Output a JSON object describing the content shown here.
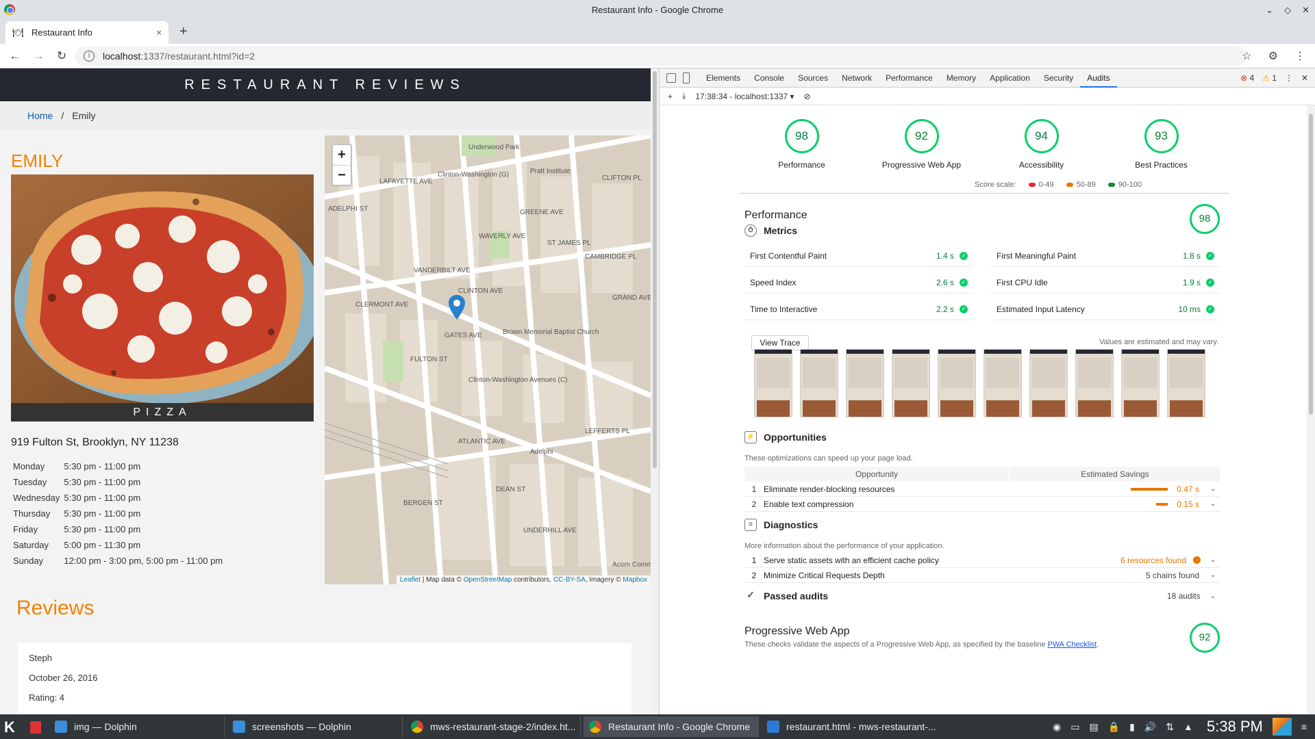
{
  "window": {
    "title": "Restaurant Info - Google Chrome"
  },
  "tab": {
    "title": "Restaurant Info",
    "close": "×"
  },
  "newtab": "+",
  "address": {
    "host": "localhost",
    "rest": ":1337/restaurant.html?id=2"
  },
  "page": {
    "site_title": "RESTAURANT REVIEWS",
    "breadcrumb": {
      "home": "Home",
      "sep": "/",
      "current": "Emily"
    },
    "restaurant": {
      "name": "EMILY",
      "cuisine": "PIZZA",
      "address": "919 Fulton St, Brooklyn, NY 11238",
      "hours": [
        {
          "day": "Monday",
          "time": "5:30 pm - 11:00 pm"
        },
        {
          "day": "Tuesday",
          "time": "5:30 pm - 11:00 pm"
        },
        {
          "day": "Wednesday",
          "time": "5:30 pm - 11:00 pm"
        },
        {
          "day": "Thursday",
          "time": "5:30 pm - 11:00 pm"
        },
        {
          "day": "Friday",
          "time": "5:30 pm - 11:00 pm"
        },
        {
          "day": "Saturday",
          "time": "5:00 pm - 11:30 pm"
        },
        {
          "day": "Sunday",
          "time": "12:00 pm - 3:00 pm, 5:00 pm - 11:00 pm"
        }
      ]
    },
    "map": {
      "zoom_in": "+",
      "zoom_out": "−",
      "attrib": {
        "leaflet": "Leaflet",
        "t1": " | Map data © ",
        "osm": "OpenStreetMap",
        "t2": " contributors, ",
        "cc": "CC-BY-SA",
        "t3": ", Imagery © ",
        "mapbox": "Mapbox"
      },
      "labels": [
        "LAFAYETTE AVE",
        "Clinton-Washington (G)",
        "Pratt Institute",
        "CLIFTON PL",
        "Underwood Park",
        "GREENE AVE",
        "GATES AVE",
        "FULTON ST",
        "ATLANTIC AVE",
        "Clinton-Washington Avenues (C)",
        "Brown Memorial Baptist Church",
        "Adelphi",
        "DEAN ST",
        "BERGEN ST",
        "LEFFERTS PL",
        "VANDERBILT AVE",
        "CLINTON AVE",
        "WAVERLY AVE",
        "ST JAMES PL",
        "CAMBRIDGE PL",
        "GRAND AVE",
        "CLERMONT AVE",
        "ADELPHI ST",
        "UNDERHILL AVE",
        "Acorn Communit"
      ]
    },
    "reviews": {
      "title": "Reviews",
      "first": {
        "name": "Steph",
        "date": "October 26, 2016",
        "rating": "Rating: 4"
      }
    }
  },
  "devtools": {
    "tabs": [
      "Elements",
      "Console",
      "Sources",
      "Network",
      "Performance",
      "Memory",
      "Application",
      "Security",
      "Audits"
    ],
    "errors": "4",
    "warnings": "1",
    "subbar": {
      "session": "17:38:34 - localhost:1337"
    },
    "gauges": [
      {
        "score": "98",
        "label": "Performance"
      },
      {
        "score": "92",
        "label": "Progressive Web App"
      },
      {
        "score": "94",
        "label": "Accessibility"
      },
      {
        "score": "93",
        "label": "Best Practices"
      }
    ],
    "scale": {
      "label": "Score scale:",
      "r1": "0-49",
      "r2": "50-89",
      "r3": "90-100",
      "c1": "#e8282c",
      "c2": "#e67700",
      "c3": "#0a8a3a"
    },
    "performance": {
      "title": "Performance",
      "score": "98",
      "metrics_title": "Metrics",
      "metrics": [
        {
          "name": "First Contentful Paint",
          "value": "1.4 s"
        },
        {
          "name": "First Meaningful Paint",
          "value": "1.8 s"
        },
        {
          "name": "Speed Index",
          "value": "2.6 s"
        },
        {
          "name": "First CPU Idle",
          "value": "1.9 s"
        },
        {
          "name": "Time to Interactive",
          "value": "2.2 s"
        },
        {
          "name": "Estimated Input Latency",
          "value": "10 ms"
        }
      ],
      "view_trace": "View Trace",
      "note": "Values are estimated and may vary.",
      "opp_title": "Opportunities",
      "opp_desc": "These optimizations can speed up your page load.",
      "opp_head": {
        "c1": "Opportunity",
        "c2": "Estimated Savings"
      },
      "opps": [
        {
          "n": "1",
          "title": "Eliminate render-blocking resources",
          "saving": "0.47 s",
          "savings_s": 0.47
        },
        {
          "n": "2",
          "title": "Enable text compression",
          "saving": "0.15 s",
          "savings_s": 0.15
        }
      ],
      "diag_title": "Diagnostics",
      "diag_desc": "More information about the performance of your application.",
      "diags": [
        {
          "n": "1",
          "title": "Serve static assets with an efficient cache policy",
          "result": "6 resources found"
        },
        {
          "n": "2",
          "title": "Minimize Critical Requests Depth",
          "result": "5 chains found"
        }
      ],
      "passed_title": "Passed audits",
      "passed_count": "18 audits"
    },
    "pwa": {
      "title": "Progressive Web App",
      "score": "92",
      "desc": "These checks validate the aspects of a Progressive Web App, as specified by the baseline ",
      "link": "PWA Checklist",
      "end": "."
    }
  },
  "taskbar": {
    "items": [
      {
        "label": "img — Dolphin"
      },
      {
        "label": "screenshots — Dolphin"
      },
      {
        "label": "mws-restaurant-stage-2/index.ht..."
      },
      {
        "label": "Restaurant Info - Google Chrome"
      },
      {
        "label": "restaurant.html - mws-restaurant-..."
      }
    ],
    "clock": "5:38 PM"
  }
}
